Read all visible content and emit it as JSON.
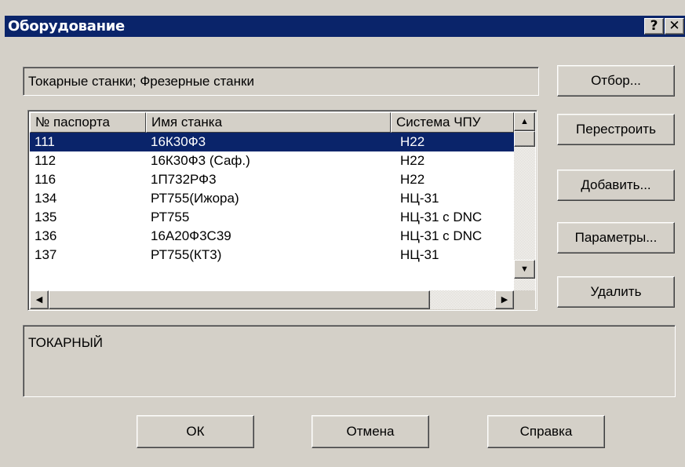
{
  "window": {
    "title": "Оборудование",
    "help_label": "?",
    "close_label": "✕"
  },
  "filter": {
    "value": "Токарные станки; Фрезерные станки"
  },
  "side_buttons": {
    "select": "Отбор...",
    "rebuild": "Перестроить",
    "add": "Добавить...",
    "params": "Параметры...",
    "delete": "Удалить"
  },
  "table": {
    "columns": [
      "№ паспорта",
      "Имя станка",
      "Система ЧПУ"
    ],
    "rows": [
      [
        "111",
        "16К30Ф3",
        "Н22"
      ],
      [
        "112",
        "16К30Ф3 (Саф.)",
        "Н22"
      ],
      [
        "116",
        "1П732РФ3",
        "Н22"
      ],
      [
        "134",
        "РТ755(Ижора)",
        "НЦ-31"
      ],
      [
        "135",
        "РТ755",
        "НЦ-31 с DNC"
      ],
      [
        "136",
        "16А20Ф3С39",
        "НЦ-31 с DNC"
      ],
      [
        "137",
        "РТ755(КТ3)",
        "НЦ-31"
      ]
    ],
    "selected_index": 0
  },
  "description": {
    "value": "ТОКАРНЫЙ"
  },
  "footer": {
    "ok": "ОК",
    "cancel": "Отмена",
    "help": "Справка"
  }
}
